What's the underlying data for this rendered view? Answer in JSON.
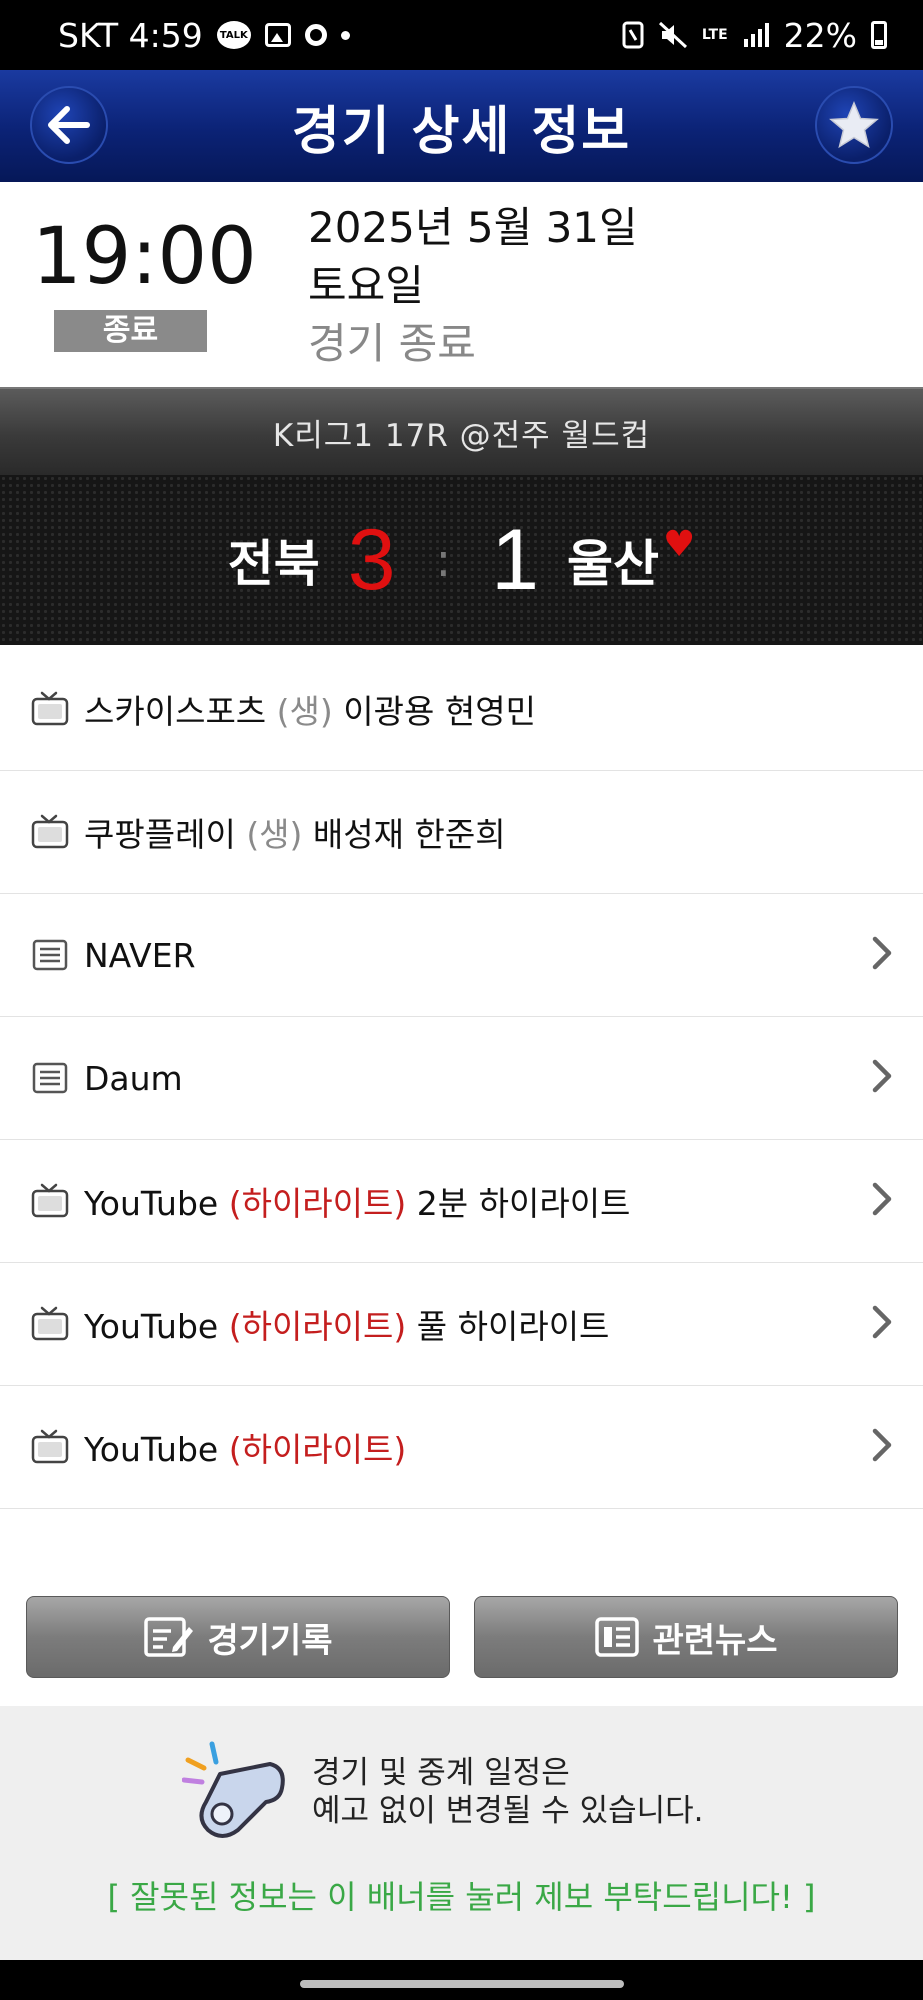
{
  "status_bar": {
    "carrier_time": "SKT 4:59",
    "talk_badge": "TALK",
    "network": "LTE",
    "battery": "22%",
    "icons": [
      "talk-icon",
      "gallery-icon",
      "ring-icon",
      "dot-icon",
      "nfc-icon",
      "mute-icon",
      "signal-icon",
      "battery-icon"
    ]
  },
  "header": {
    "title": "경기 상세 정보",
    "back_icon": "arrow-left-icon",
    "favorite_icon": "star-icon"
  },
  "match_info": {
    "time": "19:00",
    "badge": "종료",
    "date": "2025년 5월 31일",
    "weekday": "토요일",
    "status": "경기 종료"
  },
  "league": {
    "text": "K리그1 17R @전주 월드컵"
  },
  "score": {
    "home_team": "전북",
    "home_score": "3",
    "separator": ":",
    "away_score": "1",
    "away_team": "울산",
    "favorite_mark": "♥"
  },
  "broadcasts": [
    {
      "icon": "tv-icon",
      "name": "스카이스포츠",
      "tag": "(생)",
      "tag_style": "muted",
      "detail": "이광용 현영민",
      "has_arrow": false
    },
    {
      "icon": "tv-icon",
      "name": "쿠팡플레이",
      "tag": "(생)",
      "tag_style": "muted",
      "detail": "배성재 한준희",
      "has_arrow": false
    },
    {
      "icon": "document-icon",
      "name": "NAVER",
      "tag": "",
      "tag_style": "",
      "detail": "",
      "has_arrow": true
    },
    {
      "icon": "document-icon",
      "name": "Daum",
      "tag": "",
      "tag_style": "",
      "detail": "",
      "has_arrow": true
    },
    {
      "icon": "tv-icon",
      "name": "YouTube",
      "tag": "(하이라이트)",
      "tag_style": "red",
      "detail": "2분 하이라이트",
      "has_arrow": true
    },
    {
      "icon": "tv-icon",
      "name": "YouTube",
      "tag": "(하이라이트)",
      "tag_style": "red",
      "detail": "풀 하이라이트",
      "has_arrow": true
    },
    {
      "icon": "tv-icon",
      "name": "YouTube",
      "tag": "(하이라이트)",
      "tag_style": "red",
      "detail": "",
      "has_arrow": true
    }
  ],
  "buttons": {
    "record": "경기기록",
    "news": "관련뉴스"
  },
  "notice": {
    "line1": "경기 및 중계 일정은",
    "line2": "예고 없이 변경될 수 있습니다.",
    "report": "[ 잘못된 정보는 이 배너를 눌러 제보 부탁드립니다! ]"
  },
  "colors": {
    "header_blue": "#0b2275",
    "score_red": "#e01010",
    "highlight_red": "#c41e1e",
    "report_green": "#3aa846"
  }
}
